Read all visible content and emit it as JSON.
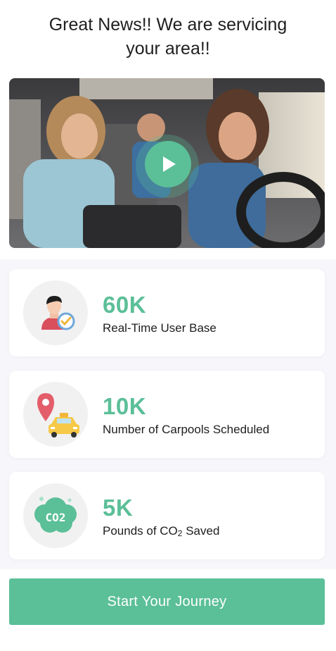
{
  "headline": {
    "line1": "Great News!! We are servicing",
    "line2": "your area!!"
  },
  "video": {
    "icon": "play-icon",
    "accent": "#5bbf98"
  },
  "stats": [
    {
      "value": "60K",
      "label": "Real-Time User Base",
      "icon": "verified-user-icon"
    },
    {
      "value": "10K",
      "label": "Number of Carpools Scheduled",
      "icon": "taxi-location-icon"
    },
    {
      "value": "5K",
      "label_prefix": "Pounds of CO",
      "label_sub": "2",
      "label_suffix": " Saved",
      "icon": "co2-cloud-icon"
    }
  ],
  "cta": {
    "label": "Start Your Journey"
  },
  "colors": {
    "accent": "#5bbf98",
    "text": "#1e1e1e",
    "card_bg": "#ffffff",
    "section_bg": "#f7f7fb"
  }
}
